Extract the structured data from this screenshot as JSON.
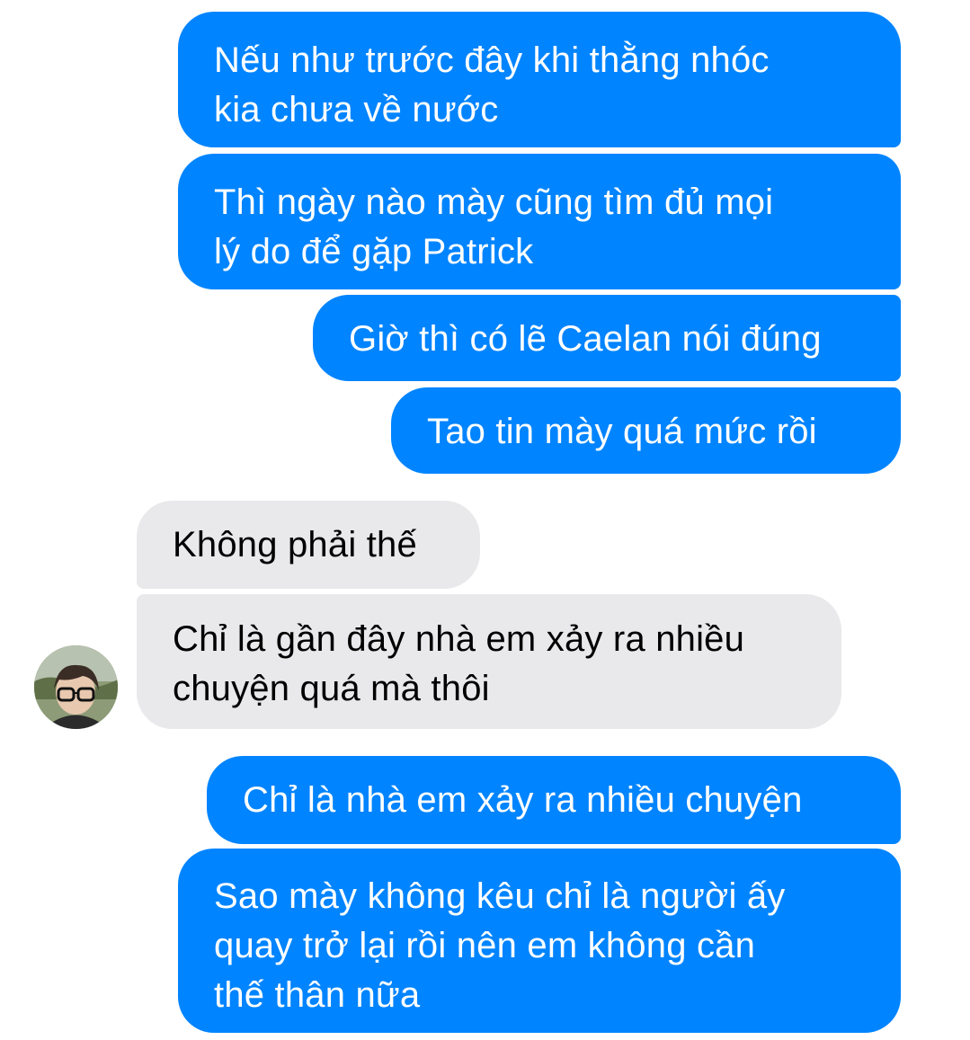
{
  "messages": [
    {
      "sender": "me",
      "text": "Nếu như trước đây khi thằng nhóc\nkia chưa về nước"
    },
    {
      "sender": "me",
      "text": "Thì ngày nào mày cũng tìm đủ mọi\nlý do để gặp Patrick"
    },
    {
      "sender": "me",
      "text": "Giờ thì có lẽ Caelan nói đúng"
    },
    {
      "sender": "me",
      "text": "Tao tin mày quá mức rồi"
    },
    {
      "sender": "other",
      "text": "Không phải thế"
    },
    {
      "sender": "other",
      "text": "Chỉ là gần đây nhà em xảy ra nhiều\nchuyện quá mà thôi"
    },
    {
      "sender": "me",
      "text": "Chỉ là nhà em xảy ra nhiều chuyện"
    },
    {
      "sender": "me",
      "text": "Sao mày không kêu chỉ là người ấy\nquay trở lại rồi nên em không cần\nthế thân nữa"
    }
  ],
  "colors": {
    "outgoing_bubble": "#0084ff",
    "incoming_bubble": "#e9e9eb",
    "outgoing_text": "#ffffff",
    "incoming_text": "#000000"
  },
  "contact": {
    "avatar_icon": "avatar-photo"
  }
}
